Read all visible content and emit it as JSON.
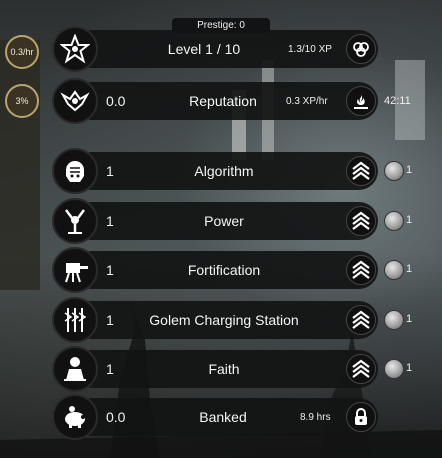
{
  "prestige": "Prestige: 0",
  "level": {
    "rate": "0.3/hr",
    "title": "Level 1 / 10",
    "xp": "1.3/10 XP",
    "xp_fraction": 0.13,
    "icon": "star-emblem-icon",
    "right_icon": "orbs-icon"
  },
  "reputation": {
    "rate": "3%",
    "value": "0.0",
    "label": "Reputation",
    "xp_rate": "0.3 XP/hr",
    "timer": "42:11",
    "icon": "eagle-emblem-icon",
    "right_icon": "hand-flame-icon"
  },
  "upgrades": [
    {
      "count": "1",
      "label": "Algorithm",
      "icon": "brain-head-icon",
      "cost": "1"
    },
    {
      "count": "1",
      "label": "Power",
      "icon": "power-figure-icon",
      "cost": "1"
    },
    {
      "count": "1",
      "label": "Fortification",
      "icon": "turret-icon",
      "cost": "1"
    },
    {
      "count": "1",
      "label": "Golem Charging Station",
      "icon": "lightning-rods-icon",
      "cost": "1"
    },
    {
      "count": "1",
      "label": "Faith",
      "icon": "praying-figure-icon",
      "cost": "1"
    }
  ],
  "banked": {
    "value": "0.0",
    "label": "Banked",
    "time": "8.9 hrs",
    "icon": "piggy-bank-icon",
    "right_icon": "padlock-icon"
  },
  "colors": {
    "xp_bar": "#39a835",
    "rate_border": "#b8a56a"
  }
}
